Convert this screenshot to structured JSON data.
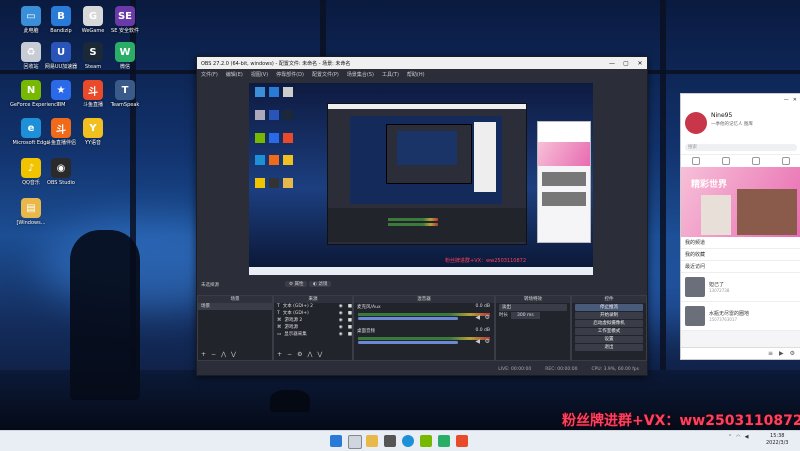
{
  "desktop": {
    "icons": [
      {
        "label": "此电脑",
        "color": "#3a8fd8",
        "glyph": "▭"
      },
      {
        "label": "Bandizip",
        "color": "#2a7ad8",
        "glyph": "B"
      },
      {
        "label": "WeGame",
        "color": "#d8d8d8",
        "glyph": "G"
      },
      {
        "label": "SE 安全软件",
        "color": "#6a3aa8",
        "glyph": "SE"
      },
      {
        "label": "回收站",
        "color": "#c8ccd4",
        "glyph": "♻"
      },
      {
        "label": "网易UU加速器",
        "color": "#2a55b8",
        "glyph": "U"
      },
      {
        "label": "Steam",
        "color": "#1b2838",
        "glyph": "S"
      },
      {
        "label": "微信",
        "color": "#2aae67",
        "glyph": "W"
      },
      {
        "label": "GeForce Experience",
        "color": "#76b900",
        "glyph": "N"
      },
      {
        "label": "TIM",
        "color": "#2a6ae8",
        "glyph": "★"
      },
      {
        "label": "斗鱼直播",
        "color": "#e84a2a",
        "glyph": "斗"
      },
      {
        "label": "TeamSpeak",
        "color": "#3a5a8a",
        "glyph": "T"
      },
      {
        "label": "Microsoft Edge",
        "color": "#1e90d8",
        "glyph": "e"
      },
      {
        "label": "斗鱼直播伴侣",
        "color": "#f06a1a",
        "glyph": "斗"
      },
      {
        "label": "YY语音",
        "color": "#f0c020",
        "glyph": "Y"
      },
      {
        "label": "QQ音乐",
        "color": "#f2c400",
        "glyph": "♪"
      },
      {
        "label": "OBS Studio",
        "color": "#2a2a2a",
        "glyph": "◉"
      },
      {
        "label": "[Windows...",
        "color": "#e8b84a",
        "glyph": "▤"
      }
    ]
  },
  "obs": {
    "title": "OBS 27.2.0 (64-bit, windows) - 配置文件: 未命名 - 场景: 未命名",
    "menu": [
      "文件(F)",
      "编辑(E)",
      "视图(V)",
      "停靠部件(D)",
      "配置文件(P)",
      "场景集合(S)",
      "工具(T)",
      "帮助(H)"
    ],
    "source_label": "未选择源",
    "props_label": "属性",
    "filters_label": "滤镜",
    "panels": {
      "scenes": {
        "title": "场景",
        "items": [
          "场景"
        ]
      },
      "sources": {
        "title": "来源",
        "items": [
          "文本 (GDI+) 2",
          "文本 (GDI+)",
          "游戏源 2",
          "游戏源",
          "显示器采集"
        ]
      },
      "mixer": {
        "title": "混音器",
        "channels": [
          {
            "name": "麦克风/Aux",
            "level": "0.0 dB"
          },
          {
            "name": "桌面音频",
            "level": "0.0 dB"
          }
        ]
      },
      "transitions": {
        "title": "转场特效",
        "type": "淡出",
        "duration_label": "时长",
        "duration": "300 ms"
      },
      "controls": {
        "title": "控件",
        "buttons": [
          "停止推流",
          "开始录制",
          "启动虚拟摄像机",
          "工作室模式",
          "设置",
          "退出"
        ]
      }
    },
    "status": {
      "live": "LIVE: 00:00:00",
      "rec": "REC: 00:00:00",
      "cpu": "CPU: 3.9%, 60.00 fps"
    }
  },
  "qq": {
    "username": "Nine95",
    "signature": "一季他的记忆人 图库",
    "search_placeholder": "搜索",
    "banner_text": "精彩世界",
    "items": [
      {
        "title": "我的频道"
      },
      {
        "title": "我的收藏"
      },
      {
        "title": "最近访问"
      },
      {
        "title": "妲己了",
        "sub": "13072738"
      },
      {
        "title": "水瓶无尽雷的圈地",
        "sub": "15073763017"
      }
    ]
  },
  "taskbar": {
    "time": "15:38",
    "date": "2022/3/3"
  },
  "watermark": "粉丝牌进群+VX：ww2503110872"
}
